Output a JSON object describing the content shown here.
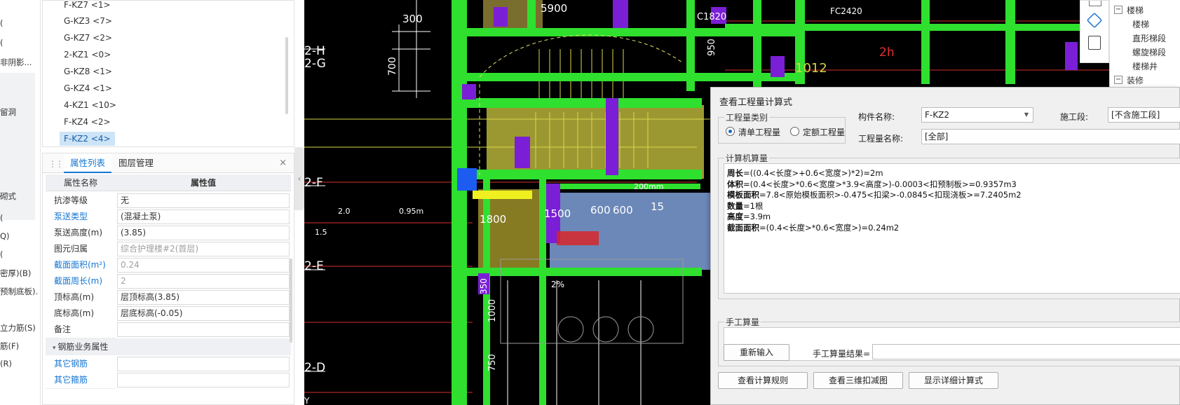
{
  "left_strip": [
    "(",
    "(",
    "非阴影...",
    "留洞",
    "砌式",
    "(",
    "Q)",
    "(",
    "密厚)(B)",
    "预制底板).",
    "立力筋(S)",
    "筋(F)",
    "(R)"
  ],
  "component_list": {
    "items": [
      "F-KZ7 <1>",
      "G-KZ3 <7>",
      "G-KZ7 <2>",
      "2-KZ1 <0>",
      "G-KZ8 <1>",
      "G-KZ4 <1>",
      "4-KZ1 <10>",
      "F-KZ4 <2>",
      "F-KZ2 <4>"
    ],
    "selected": "F-KZ2 <4>"
  },
  "property_panel": {
    "tab_attr": "属性列表",
    "tab_layer": "图层管理",
    "close": "×",
    "col_name": "属性名称",
    "col_value": "属性值",
    "rows": [
      {
        "name": "抗渗等级",
        "value": "无"
      },
      {
        "name": "泵送类型",
        "value": "(混凝土泵)"
      },
      {
        "name": "泵送高度(m)",
        "value": "(3.85)"
      },
      {
        "name": "图元归属",
        "value": "综合护理楼#2(首层)"
      },
      {
        "name": "截面面积(m²)",
        "value": "0.24"
      },
      {
        "name": "截面周长(m)",
        "value": "2"
      },
      {
        "name": "顶标高(m)",
        "value": "层顶标高(3.85)"
      },
      {
        "name": "底标高(m)",
        "value": "层底标高(-0.05)"
      },
      {
        "name": "备注",
        "value": ""
      }
    ],
    "section": "钢筋业务属性",
    "rows2": [
      {
        "name": "其它钢筋",
        "value": ""
      },
      {
        "name": "其它箍筋",
        "value": ""
      }
    ]
  },
  "cad": {
    "axis_labels": [
      "2-H",
      "2-G",
      "2-F",
      "2-E",
      "2-D"
    ],
    "texts": [
      "5900",
      "300",
      "700",
      "1800",
      "1500",
      "600",
      "600",
      "15",
      "1012",
      "950",
      "C1820",
      "FC2420",
      "2h",
      "200mm",
      "0.95m",
      "2.0",
      "1.5",
      "1000",
      "750",
      "350",
      "2%",
      "Y"
    ]
  },
  "right_tree": {
    "items": [
      "楼梯",
      "楼梯",
      "直形梯段",
      "螺旋梯段",
      "楼梯井",
      "装修"
    ],
    "expand": "−"
  },
  "dialog": {
    "title": "查看工程量计算式",
    "group_type": "工程量类别",
    "radio_list": "清单工程量",
    "radio_quota": "定额工程量",
    "comp_name_label": "构件名称:",
    "comp_name_value": "F-KZ2",
    "stage_label": "施工段:",
    "stage_value": "[不含施工段]",
    "qty_name_label": "工程量名称:",
    "qty_name_value": "[全部]",
    "calc_title": "计算机算量",
    "calc_lines": [
      {
        "k": "周长",
        "v": "=((0.4<长度>+0.6<宽度>)*2)=2m"
      },
      {
        "k": "体积",
        "v": "=(0.4<长度>*0.6<宽度>*3.9<高度>)-0.0003<扣预制板>=0.9357m3"
      },
      {
        "k": "模板面积",
        "v": "=7.8<原始模板面积>-0.475<扣梁>-0.0845<扣现浇板>=7.2405m2"
      },
      {
        "k": "数量",
        "v": "=1根"
      },
      {
        "k": "高度",
        "v": "=3.9m"
      },
      {
        "k": "截面面积",
        "v": "=(0.4<长度>*0.6<宽度>)=0.24m2"
      }
    ],
    "manual_title": "手工算量",
    "reinput": "重新输入",
    "manual_result_label": "手工算量结果=",
    "btn1": "查看计算规则",
    "btn2": "查看三维扣减图",
    "btn3": "显示详细计算式"
  },
  "colors": {
    "accent": "#1677d2",
    "cad_bg": "#000000",
    "cad_green": "#2fe02f",
    "cad_yellow": "#c8c820",
    "cad_purple": "#7a1fd6"
  }
}
